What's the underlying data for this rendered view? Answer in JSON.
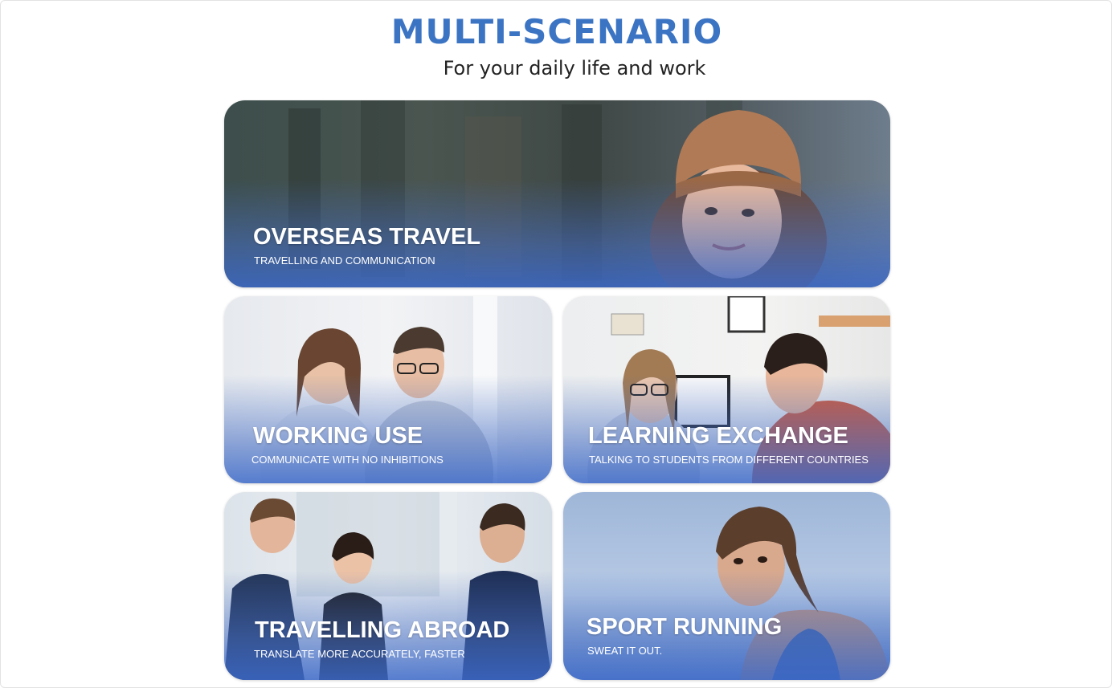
{
  "header": {
    "title": "MULTI-SCENARIO",
    "subtitle": "For your daily life and work"
  },
  "scenarios": [
    {
      "title": "OVERSEAS TRAVEL",
      "subtitle": "TRAVELLING AND COMMUNICATION"
    },
    {
      "title": "WORKING USE",
      "subtitle": "COMMUNICATE WITH NO INHIBITIONS"
    },
    {
      "title": "LEARNING EXCHANGE",
      "subtitle": "TALKING TO STUDENTS FROM DIFFERENT COUNTRIES"
    },
    {
      "title": "TRAVELLING ABROAD",
      "subtitle": "TRANSLATE MORE ACCURATELY, FASTER"
    },
    {
      "title": "SPORT RUNNING",
      "subtitle": "SWEAT IT OUT."
    }
  ],
  "colors": {
    "title": "#3c74c4",
    "card_overlay": "#3c69c8"
  }
}
